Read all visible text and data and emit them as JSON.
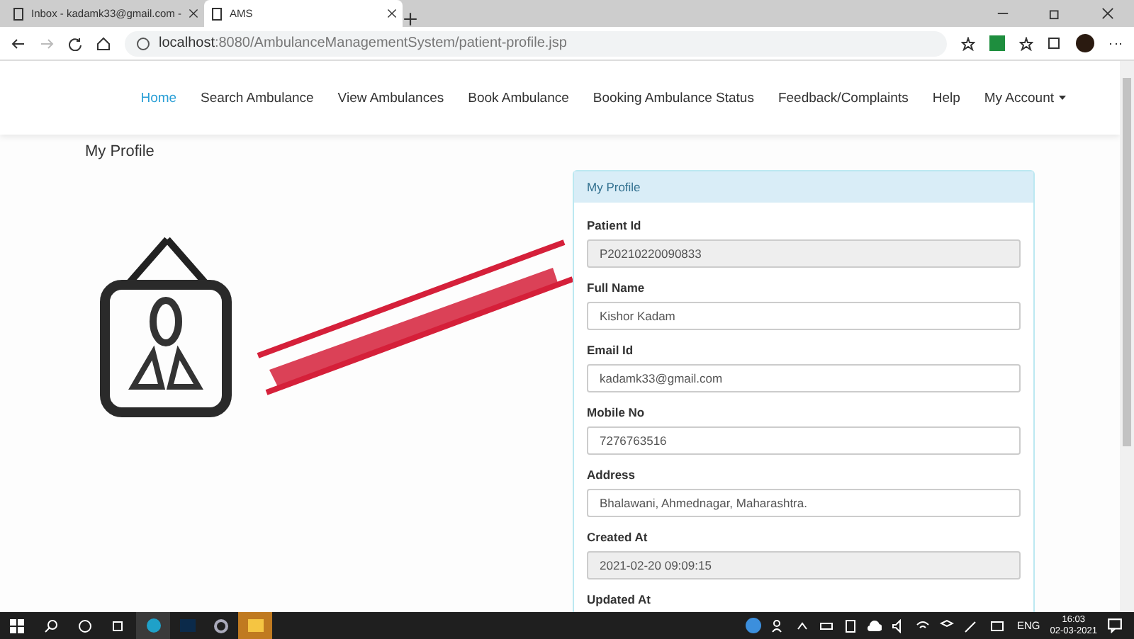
{
  "browser": {
    "tabs": [
      {
        "title": "Inbox - kadamk33@gmail.com -",
        "selected": false
      },
      {
        "title": "AMS",
        "selected": true
      }
    ],
    "url_host": "localhost",
    "url_path": ":8080/AmbulanceManagementSystem/patient-profile.jsp"
  },
  "nav": [
    {
      "label": "Home",
      "selected": true
    },
    {
      "label": "Search Ambulance",
      "selected": false
    },
    {
      "label": "View Ambulances",
      "selected": false
    },
    {
      "label": "Book Ambulance",
      "selected": false
    },
    {
      "label": "Booking Ambulance Status",
      "selected": false
    },
    {
      "label": "Feedback/Complaints",
      "selected": false
    },
    {
      "label": "Help",
      "selected": false
    },
    {
      "label": "My Account",
      "selected": false,
      "dropdown": true
    }
  ],
  "page_title": "My Profile",
  "panel": {
    "title": "My Profile",
    "fields": [
      {
        "label": "Patient Id",
        "value": "P20210220090833",
        "disabled": true
      },
      {
        "label": "Full Name",
        "value": "Kishor Kadam",
        "disabled": false
      },
      {
        "label": "Email Id",
        "value": "kadamk33@gmail.com",
        "disabled": false
      },
      {
        "label": "Mobile No",
        "value": "7276763516",
        "disabled": false
      },
      {
        "label": "Address",
        "value": "Bhalawani, Ahmednagar, Maharashtra.",
        "disabled": false
      },
      {
        "label": "Created At",
        "value": "2021-02-20 09:09:15",
        "disabled": true
      },
      {
        "label": "Updated At"
      }
    ]
  },
  "taskbar": {
    "language": "ENG",
    "time": "16:03",
    "date": "02-03-2021"
  }
}
